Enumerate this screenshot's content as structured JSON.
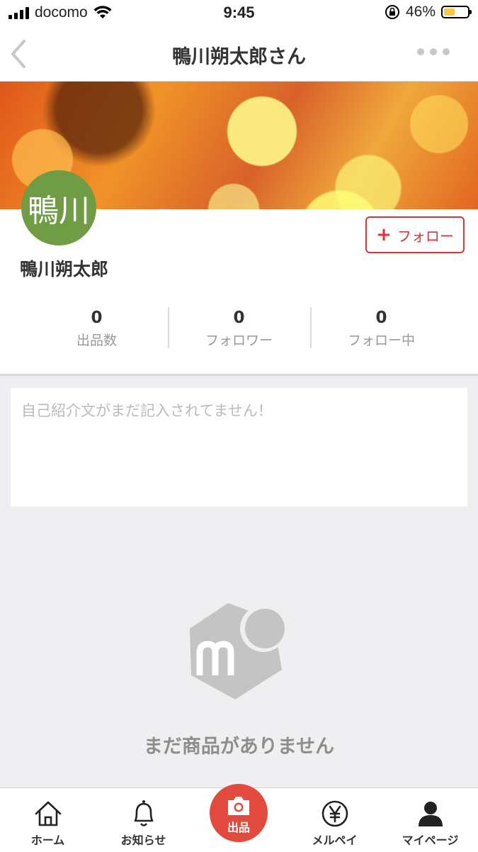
{
  "status_bar": {
    "carrier": "docomo",
    "time": "9:45",
    "battery": "46%",
    "battery_level": 0.46
  },
  "nav": {
    "title": "鴨川朔太郎さん",
    "back_icon": "chevron-left-icon",
    "more_icon": "ellipsis-icon"
  },
  "profile": {
    "avatar_text": "鴨川",
    "avatar_color": "#6f9c44",
    "name": "鴨川朔太郎",
    "follow_plus": "+",
    "follow_label": "フォロー",
    "stats": [
      {
        "value": "0",
        "label": "出品数"
      },
      {
        "value": "0",
        "label": "フォロワー"
      },
      {
        "value": "0",
        "label": "フォロー中"
      }
    ]
  },
  "intro": {
    "placeholder": "自己紹介文がまだ記入されてません！"
  },
  "empty_state": {
    "icon": "mercari-box-icon",
    "text": "まだ商品がありません"
  },
  "tabbar": {
    "items": [
      {
        "label": "ホーム",
        "icon": "home-icon"
      },
      {
        "label": "お知らせ",
        "icon": "bell-icon"
      },
      {
        "label": "出品",
        "icon": "camera-icon"
      },
      {
        "label": "メルペイ",
        "icon": "yen-icon"
      },
      {
        "label": "マイページ",
        "icon": "person-icon"
      }
    ],
    "accent": "#e14a3c"
  },
  "colors": {
    "follow": "#dd3333",
    "background": "#efeff1"
  }
}
